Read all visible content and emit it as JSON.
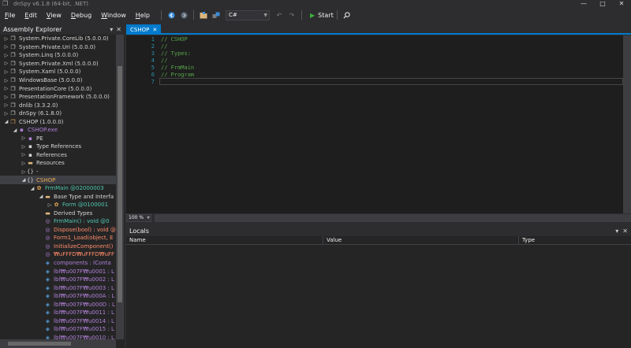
{
  "window": {
    "title": "dnSpy v6.1.8 (64-bit, .NET)",
    "minimize": "—",
    "maximize": "□",
    "close": "✕"
  },
  "menu": [
    {
      "label": "File",
      "u": "F",
      "rest": "ile"
    },
    {
      "label": "Edit",
      "u": "E",
      "rest": "dit"
    },
    {
      "label": "View",
      "u": "V",
      "rest": "iew"
    },
    {
      "label": "Debug",
      "u": "D",
      "rest": "ebug"
    },
    {
      "label": "Window",
      "u": "W",
      "rest": "indow"
    },
    {
      "label": "Help",
      "u": "H",
      "rest": "elp"
    }
  ],
  "toolbar": {
    "language": "C#",
    "start_label": "Start"
  },
  "assembly_explorer": {
    "title": "Assembly Explorer",
    "items": [
      {
        "indent": 0,
        "tw": "▷",
        "icon": "❐",
        "text": "System.Private.CoreLib (5.0.0.0)",
        "color": "#d4d4d4"
      },
      {
        "indent": 0,
        "tw": "▷",
        "icon": "❐",
        "text": "System.Private.Uri (5.0.0.0)",
        "color": "#d4d4d4"
      },
      {
        "indent": 0,
        "tw": "▷",
        "icon": "❐",
        "text": "System.Linq (5.0.0.0)",
        "color": "#d4d4d4"
      },
      {
        "indent": 0,
        "tw": "▷",
        "icon": "❐",
        "text": "System.Private.Xml (5.0.0.0)",
        "color": "#d4d4d4"
      },
      {
        "indent": 0,
        "tw": "▷",
        "icon": "❐",
        "text": "System.Xaml (5.0.0.0)",
        "color": "#d4d4d4"
      },
      {
        "indent": 0,
        "tw": "▷",
        "icon": "❐",
        "text": "WindowsBase (5.0.0.0)",
        "color": "#d4d4d4"
      },
      {
        "indent": 0,
        "tw": "▷",
        "icon": "❐",
        "text": "PresentationCore (5.0.0.0)",
        "color": "#d4d4d4"
      },
      {
        "indent": 0,
        "tw": "▷",
        "icon": "❐",
        "text": "PresentationFramework (5.0.0.0)",
        "color": "#d4d4d4"
      },
      {
        "indent": 0,
        "tw": "▷",
        "icon": "❐",
        "text": "dnlib (3.3.2.0)",
        "color": "#d4d4d4"
      },
      {
        "indent": 0,
        "tw": "▷",
        "icon": "❐",
        "text": "dnSpy (6.1.8.0)",
        "color": "#d4d4d4"
      },
      {
        "indent": 0,
        "tw": "◢",
        "icon": "❐",
        "text": "CSHOP (1.0.0.0)",
        "color": "#d4d4d4",
        "iconColor": "#e8ab53"
      },
      {
        "indent": 1,
        "tw": "◢",
        "icon": "▪",
        "text": "CSHOP.exe",
        "color": "#b180d7",
        "iconColor": "#b180d7"
      },
      {
        "indent": 2,
        "tw": "▷",
        "icon": "▪",
        "text": "PE",
        "color": "#d4d4d4",
        "iconColor": "#b180d7"
      },
      {
        "indent": 2,
        "tw": "▷",
        "icon": "▪",
        "text": "Type References",
        "color": "#d4d4d4",
        "iconColor": "#d4d4d4"
      },
      {
        "indent": 2,
        "tw": "▷",
        "icon": "▪",
        "text": "References",
        "color": "#d4d4d4",
        "iconColor": "#d4d4d4"
      },
      {
        "indent": 2,
        "tw": "▷",
        "icon": "▬",
        "text": "Resources",
        "color": "#d4d4d4",
        "iconColor": "#dcb67a"
      },
      {
        "indent": 2,
        "tw": "▷",
        "icon": "{}",
        "text": "-",
        "color": "#d4d4d4",
        "iconColor": "#d4d4d4"
      },
      {
        "indent": 2,
        "tw": "◢",
        "icon": "{}",
        "text": "CSHOP",
        "color": "#e8ab53",
        "iconColor": "#d4d4d4",
        "selected": true
      },
      {
        "indent": 3,
        "tw": "◢",
        "icon": "✿",
        "text": "FrmMain @02000003",
        "color": "#4ec9b0",
        "iconColor": "#e8ab53"
      },
      {
        "indent": 4,
        "tw": "◢",
        "icon": "▬",
        "text": "Base Type and Interfa",
        "color": "#d4d4d4",
        "iconColor": "#dcb67a"
      },
      {
        "indent": 5,
        "tw": "▷",
        "icon": "✿",
        "text": "Form @0100001",
        "color": "#4ec9b0",
        "iconColor": "#e8ab53"
      },
      {
        "indent": 4,
        "tw": "",
        "icon": "▬",
        "text": "Derived Types",
        "color": "#d4d4d4",
        "iconColor": "#dcb67a"
      },
      {
        "indent": 4,
        "tw": "",
        "icon": "◎",
        "text": "FrmMain() : void @0",
        "color": "#4ec9b0",
        "iconColor": "#b180d7"
      },
      {
        "indent": 4,
        "tw": "",
        "icon": "◎",
        "text": "Dispose(bool) : void @",
        "color": "#ff8c69",
        "iconColor": "#b180d7"
      },
      {
        "indent": 4,
        "tw": "",
        "icon": "◎",
        "text": "Form1_Load(object, E",
        "color": "#ff8c69",
        "iconColor": "#b180d7"
      },
      {
        "indent": 4,
        "tw": "",
        "icon": "◎",
        "text": "InitializeComponent()",
        "color": "#ff8c69",
        "iconColor": "#b180d7"
      },
      {
        "indent": 4,
        "tw": "",
        "icon": "◎",
        "text": "₩uFFFD₩uFFFD₩uFF",
        "color": "#ff8c69",
        "iconColor": "#b180d7"
      },
      {
        "indent": 4,
        "tw": "",
        "icon": "◈",
        "text": "components : IConta",
        "color": "#b180d7",
        "iconColor": "#569cd6"
      },
      {
        "indent": 4,
        "tw": "",
        "icon": "◈",
        "text": "lbl₩u007F₩u0001 : L",
        "color": "#b180d7",
        "iconColor": "#569cd6"
      },
      {
        "indent": 4,
        "tw": "",
        "icon": "◈",
        "text": "lbl₩u007F₩u0002 : L",
        "color": "#b180d7",
        "iconColor": "#569cd6"
      },
      {
        "indent": 4,
        "tw": "",
        "icon": "◈",
        "text": "lbl₩u007F₩u0003 : L",
        "color": "#b180d7",
        "iconColor": "#569cd6"
      },
      {
        "indent": 4,
        "tw": "",
        "icon": "◈",
        "text": "lbl₩u007F₩u000A : L",
        "color": "#b180d7",
        "iconColor": "#569cd6"
      },
      {
        "indent": 4,
        "tw": "",
        "icon": "◈",
        "text": "lbl₩u007F₩u000D : L",
        "color": "#b180d7",
        "iconColor": "#569cd6"
      },
      {
        "indent": 4,
        "tw": "",
        "icon": "◈",
        "text": "lbl₩u007F₩u0011 : L",
        "color": "#b180d7",
        "iconColor": "#569cd6"
      },
      {
        "indent": 4,
        "tw": "",
        "icon": "◈",
        "text": "lbl₩u007F₩u0014 : L",
        "color": "#b180d7",
        "iconColor": "#569cd6"
      },
      {
        "indent": 4,
        "tw": "",
        "icon": "◈",
        "text": "lbl₩u007F₩u0015 : L",
        "color": "#b180d7",
        "iconColor": "#569cd6"
      },
      {
        "indent": 4,
        "tw": "",
        "icon": "◈",
        "text": "lbl₩u007F₩u0010 : L",
        "color": "#b180d7",
        "iconColor": "#569cd6"
      }
    ]
  },
  "editor": {
    "tab_label": "CSHOP",
    "lines": [
      {
        "n": "1",
        "code": "// CSHOP"
      },
      {
        "n": "2",
        "code": "//"
      },
      {
        "n": "3",
        "code": "// Types:"
      },
      {
        "n": "4",
        "code": "//"
      },
      {
        "n": "5",
        "code": "// FrmMain"
      },
      {
        "n": "6",
        "code": "// Program"
      },
      {
        "n": "7",
        "code": ""
      }
    ],
    "zoom": "100 %"
  },
  "locals": {
    "title": "Locals",
    "columns": [
      "Name",
      "Value",
      "Type"
    ]
  }
}
